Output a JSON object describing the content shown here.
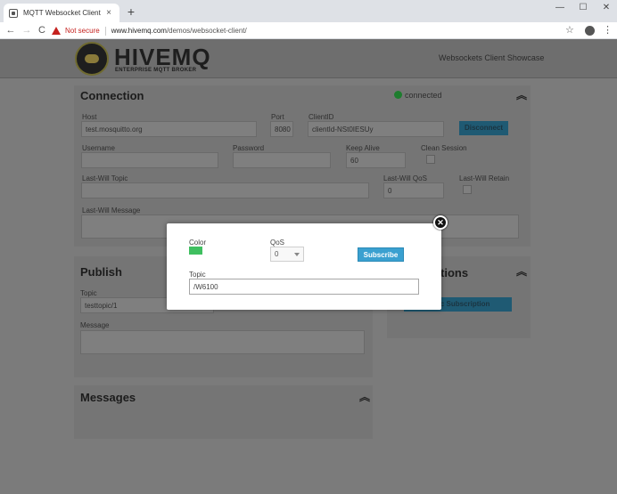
{
  "browser": {
    "tab_title": "MQTT Websocket Client",
    "tab_close": "×",
    "new_tab": "+",
    "minimize": "—",
    "maximize": "☐",
    "close": "✕",
    "back": "←",
    "forward": "→",
    "reload": "C",
    "security_label": "Not secure",
    "url_host": "www.hivemq.com",
    "url_path": "/demos/websocket-client/",
    "bookmark": "☆",
    "menu": "⋮"
  },
  "header": {
    "logo_word": "HIVEMQ",
    "logo_sub": "ENTERPRISE MQTT BROKER",
    "right_text": "Websockets Client Showcase"
  },
  "connection": {
    "title": "Connection",
    "status": "connected",
    "host_label": "Host",
    "host_value": "test.mosquitto.org",
    "port_label": "Port",
    "port_value": "8080",
    "clientid_label": "ClientID",
    "clientid_value": "clientId-NSt0IESUy",
    "disconnect_label": "Disconnect",
    "username_label": "Username",
    "password_label": "Password",
    "keepalive_label": "Keep Alive",
    "keepalive_value": "60",
    "clean_session_label": "Clean Session",
    "lastwill_topic_label": "Last-Will Topic",
    "lastwill_qos_label": "Last-Will QoS",
    "lastwill_qos_value": "0",
    "lastwill_retain_label": "Last-Will Retain",
    "lastwill_message_label": "Last-Will Message"
  },
  "publish": {
    "title": "Publish",
    "topic_label": "Topic",
    "topic_value": "testtopic/1",
    "message_label": "Message"
  },
  "subscriptions": {
    "title_partial": "tions",
    "add_button": "Topic Subscription"
  },
  "messages": {
    "title": "Messages"
  },
  "modal": {
    "color_label": "Color",
    "color_value": "#3fbf60",
    "qos_label": "QoS",
    "qos_value": "0",
    "subscribe_label": "Subscribe",
    "topic_label": "Topic",
    "topic_value": "/W6100",
    "close_glyph": "✕"
  },
  "colors": {
    "accent": "#3aa0d0",
    "status_connected": "#1e7d2e",
    "not_secure": "#c5221f"
  },
  "icons": {
    "chevron": "double-chevron-up-icon",
    "close": "close-icon"
  }
}
